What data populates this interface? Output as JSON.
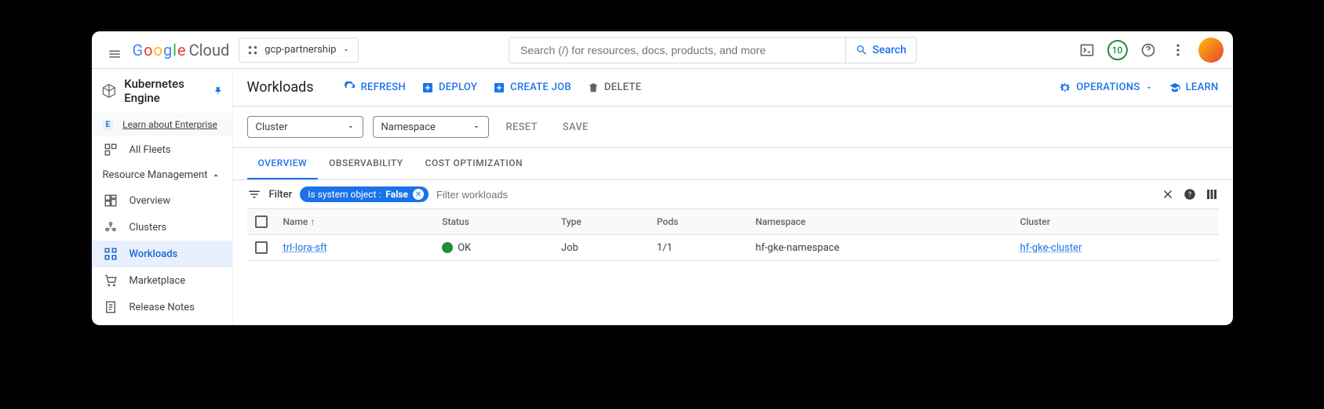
{
  "header": {
    "project": "gcp-partnership",
    "search_placeholder": "Search (/) for resources, docs, products, and more",
    "search_button": "Search",
    "credits_badge": "10"
  },
  "sidebar": {
    "title": "Kubernetes Engine",
    "enterprise_link": "Learn about Enterprise",
    "all_fleets": "All Fleets",
    "section": "Resource Management",
    "items": {
      "overview": "Overview",
      "clusters": "Clusters",
      "workloads": "Workloads",
      "marketplace": "Marketplace",
      "release_notes": "Release Notes"
    }
  },
  "actions": {
    "page_title": "Workloads",
    "refresh": "REFRESH",
    "deploy": "DEPLOY",
    "create_job": "CREATE JOB",
    "delete": "DELETE",
    "operations": "OPERATIONS",
    "learn": "LEARN"
  },
  "filters": {
    "cluster": "Cluster",
    "namespace": "Namespace",
    "reset": "RESET",
    "save": "SAVE"
  },
  "tabs": {
    "overview": "OVERVIEW",
    "observability": "OBSERVABILITY",
    "cost": "COST OPTIMIZATION"
  },
  "filterrow": {
    "label": "Filter",
    "chip_key": "Is system object :",
    "chip_val": "False",
    "placeholder": "Filter workloads"
  },
  "table": {
    "headers": {
      "name": "Name",
      "status": "Status",
      "type": "Type",
      "pods": "Pods",
      "namespace": "Namespace",
      "cluster": "Cluster"
    },
    "row": {
      "name": "trl-lora-sft",
      "status": "OK",
      "type": "Job",
      "pods": "1/1",
      "namespace": "hf-gke-namespace",
      "cluster": "hf-gke-cluster"
    }
  }
}
